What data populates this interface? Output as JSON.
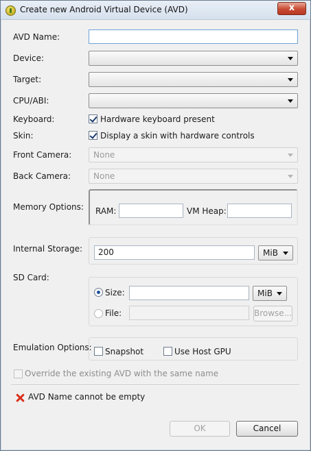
{
  "window": {
    "title": "Create new Android Virtual Device (AVD)",
    "close_glyph": "x"
  },
  "form": {
    "avd_name": {
      "label": "AVD Name:",
      "value": ""
    },
    "device": {
      "label": "Device:",
      "value": ""
    },
    "target": {
      "label": "Target:",
      "value": ""
    },
    "cpu_abi": {
      "label": "CPU/ABI:",
      "value": ""
    },
    "keyboard": {
      "label": "Keyboard:",
      "checkbox_label": "Hardware keyboard present",
      "checked": true
    },
    "skin": {
      "label": "Skin:",
      "checkbox_label": "Display a skin with hardware controls",
      "checked": true
    },
    "front_camera": {
      "label": "Front Camera:",
      "value": "None"
    },
    "back_camera": {
      "label": "Back Camera:",
      "value": "None"
    },
    "memory": {
      "label": "Memory Options:",
      "ram_label": "RAM:",
      "ram_value": "",
      "vm_heap_label": "VM Heap:",
      "vm_heap_value": ""
    },
    "internal_storage": {
      "label": "Internal Storage:",
      "value": "200",
      "unit": "MiB"
    },
    "sd_card": {
      "label": "SD Card:",
      "size_label": "Size:",
      "size_value": "",
      "size_unit": "MiB",
      "file_label": "File:",
      "file_value": "",
      "browse_label": "Browse..."
    },
    "emulation": {
      "label": "Emulation Options:",
      "snapshot_label": "Snapshot",
      "host_gpu_label": "Use Host GPU"
    },
    "override_label": "Override the existing AVD with the same name"
  },
  "status": {
    "error_text": "AVD Name cannot be empty"
  },
  "buttons": {
    "ok": "OK",
    "cancel": "Cancel"
  },
  "colors": {
    "error": "#d9321d",
    "title_bar": "#d6e1ee",
    "close_button": "#c94a32"
  }
}
